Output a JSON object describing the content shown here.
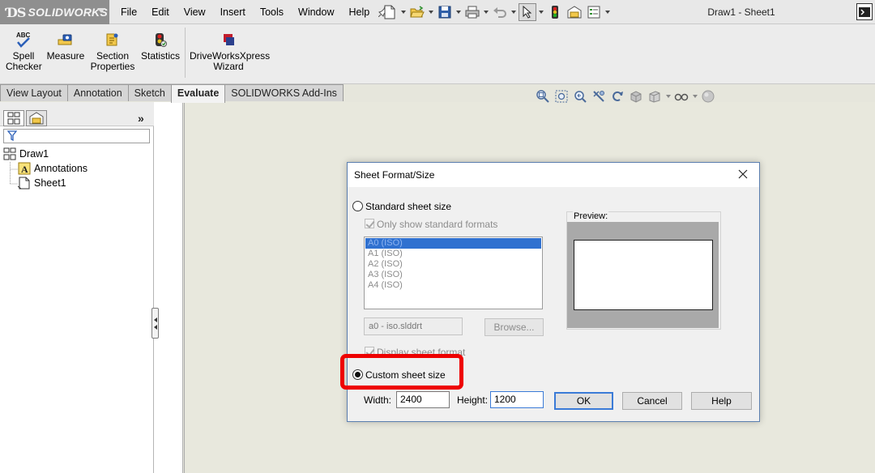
{
  "app": {
    "brand": "SOLIDWORKS",
    "logo_letters": "3S"
  },
  "menu": [
    "File",
    "Edit",
    "View",
    "Insert",
    "Tools",
    "Window",
    "Help"
  ],
  "window_title": "Draw1 - Sheet1",
  "command_manager": {
    "spell_checker": "Spell\nChecker",
    "measure": "Measure",
    "section_properties": "Section\nProperties",
    "statistics": "Statistics",
    "driveworks": "DriveWorksXpress\nWizard",
    "spell_icon_text": "ABC"
  },
  "tabs": [
    {
      "label": "View Layout",
      "active": false
    },
    {
      "label": "Annotation",
      "active": false
    },
    {
      "label": "Sketch",
      "active": false
    },
    {
      "label": "Evaluate",
      "active": true
    },
    {
      "label": "SOLIDWORKS Add-Ins",
      "active": false
    }
  ],
  "tree": {
    "root": "Draw1",
    "children": [
      "Annotations",
      "Sheet1"
    ],
    "more_label": "»"
  },
  "dialog": {
    "title": "Sheet Format/Size",
    "standard_label": "Standard sheet size",
    "only_standard_label": "Only show standard formats",
    "formats": [
      "A0 (ISO)",
      "A1 (ISO)",
      "A2 (ISO)",
      "A3 (ISO)",
      "A4 (ISO)"
    ],
    "selected_format": "A0 (ISO)",
    "file_value": "a0 - iso.slddrt",
    "browse_label": "Browse...",
    "preview_label": "Preview:",
    "display_format_label": "Display sheet format",
    "custom_label": "Custom sheet size",
    "custom_selected": true,
    "width_label": "Width:",
    "width_value": "2400",
    "height_label": "Height:",
    "height_value": "1200",
    "ok_label": "OK",
    "cancel_label": "Cancel",
    "help_label": "Help"
  },
  "colors": {
    "highlight": "#ee0000",
    "viewport_bg": "#e8e8dd",
    "list_selection": "#3071d0",
    "dialog_border": "#5b7fb0"
  }
}
